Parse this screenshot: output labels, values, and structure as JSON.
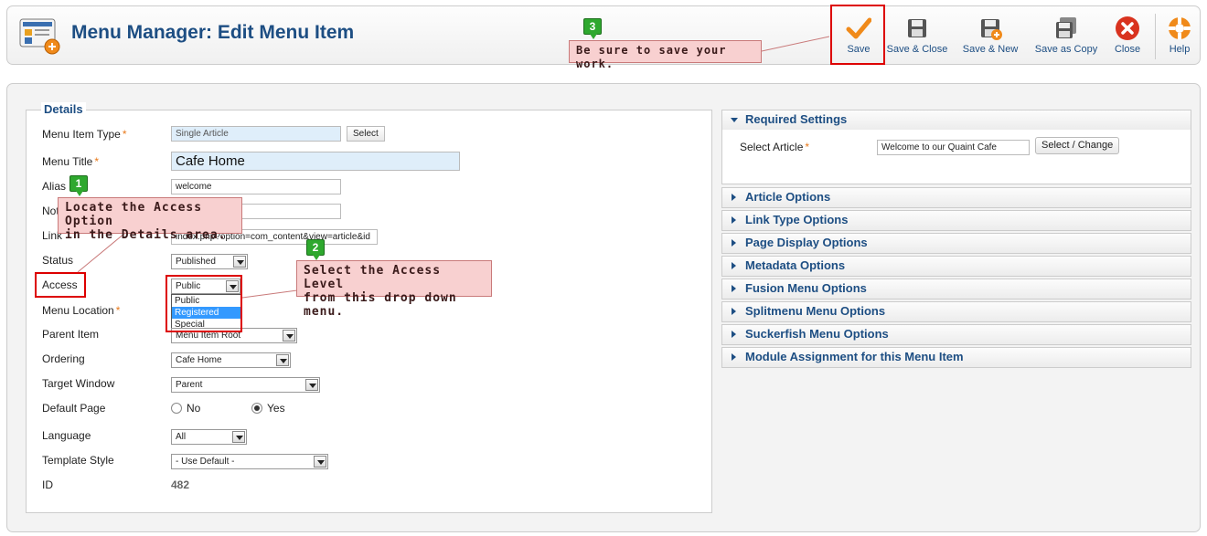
{
  "header": {
    "title": "Menu Manager: Edit Menu Item",
    "toolbar": [
      {
        "name": "save-button",
        "icon": "checkmark-icon",
        "label": "Save"
      },
      {
        "name": "save-close-button",
        "icon": "floppy-icon",
        "label": "Save & Close"
      },
      {
        "name": "save-new-button",
        "icon": "floppy-plus-icon",
        "label": "Save & New"
      },
      {
        "name": "save-copy-button",
        "icon": "floppy-copy-icon",
        "label": "Save as Copy"
      },
      {
        "name": "close-button",
        "icon": "close-icon",
        "label": "Close"
      },
      {
        "name": "help-button",
        "icon": "lifebuoy-icon",
        "label": "Help"
      }
    ]
  },
  "details": {
    "legend": "Details",
    "menu_item_type": {
      "label": "Menu Item Type",
      "value": "Single Article",
      "button": "Select"
    },
    "menu_title": {
      "label": "Menu Title",
      "value": "Cafe Home"
    },
    "alias": {
      "label": "Alias",
      "value": "welcome"
    },
    "note": {
      "label": "Note",
      "value": ""
    },
    "link": {
      "label": "Link",
      "value": "index.php?option=com_content&view=article&id"
    },
    "status": {
      "label": "Status",
      "value": "Published"
    },
    "access": {
      "label": "Access",
      "value": "Public",
      "options": [
        "Public",
        "Registered",
        "Special"
      ],
      "highlighted": "Registered"
    },
    "menu_location": {
      "label": "Menu Location",
      "value": ""
    },
    "parent_item": {
      "label": "Parent Item",
      "value": "Menu Item Root"
    },
    "ordering": {
      "label": "Ordering",
      "value": "Cafe Home"
    },
    "target_window": {
      "label": "Target Window",
      "value": "Parent"
    },
    "default_page": {
      "label": "Default Page",
      "no": "No",
      "yes": "Yes",
      "selected": "Yes"
    },
    "language": {
      "label": "Language",
      "value": "All"
    },
    "template_style": {
      "label": "Template Style",
      "value": "- Use Default -"
    },
    "id": {
      "label": "ID",
      "value": "482"
    },
    "required_marker": "*"
  },
  "sidebar": {
    "required": {
      "title": "Required Settings",
      "select_article_label": "Select Article",
      "select_article_value": "Welcome to our Quaint Cafe",
      "button": "Select / Change"
    },
    "panels": [
      "Article Options",
      "Link Type Options",
      "Page Display Options",
      "Metadata Options",
      "Fusion Menu Options",
      "Splitmenu Menu Options",
      "Suckerfish Menu Options",
      "Module Assignment for this Menu Item"
    ]
  },
  "callouts": {
    "one": {
      "badge": "1",
      "line1": "Locate the Access Option",
      "line2": "in the Details area."
    },
    "two": {
      "badge": "2",
      "line1": "Select the Access Level",
      "line2": "from this drop down menu."
    },
    "three": {
      "badge": "3",
      "text": "Be sure to save your work."
    }
  },
  "colors": {
    "accent": "#1d4e83",
    "callout_bg": "#f8d0d0",
    "badge": "#2ea82e",
    "highlight": "#dd0000"
  }
}
